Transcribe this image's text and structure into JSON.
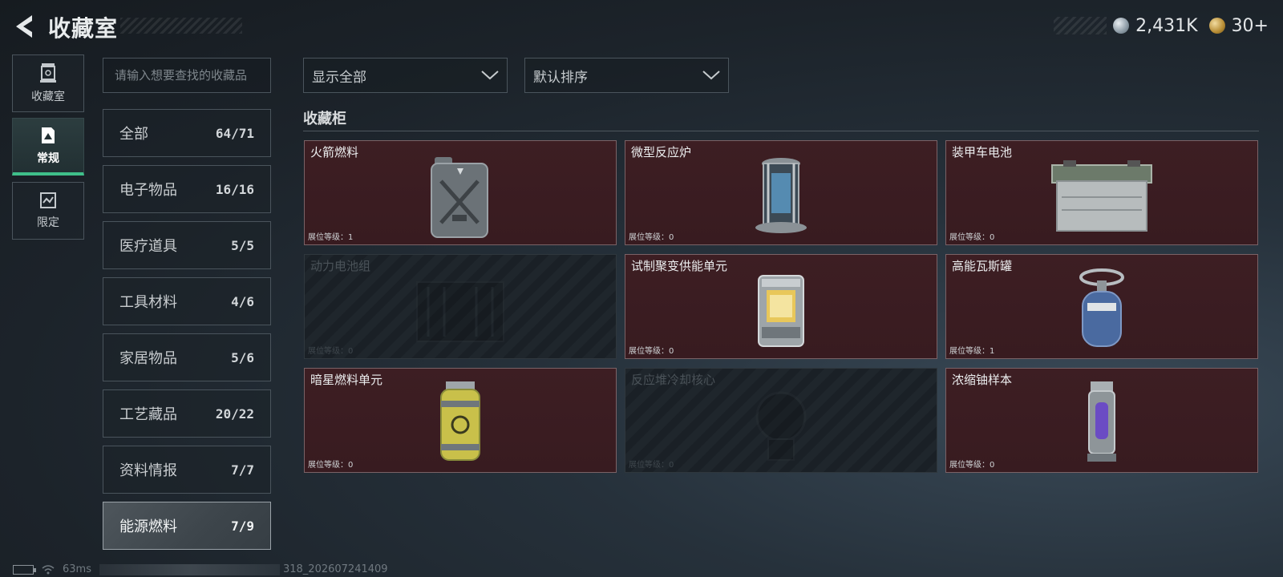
{
  "header": {
    "title": "收藏室",
    "currency": [
      {
        "icon": "silver-coin-icon",
        "value": "2,431K"
      },
      {
        "icon": "gold-coin-icon",
        "value": "30+"
      }
    ]
  },
  "rail": {
    "items": [
      {
        "label": "收藏室",
        "icon": "collection-room-icon",
        "active": false
      },
      {
        "label": "常规",
        "icon": "regular-icon",
        "active": true
      },
      {
        "label": "限定",
        "icon": "limited-icon",
        "active": false
      }
    ]
  },
  "search": {
    "placeholder": "请输入想要查找的收藏品"
  },
  "categories": [
    {
      "label": "全部",
      "count": "64/71"
    },
    {
      "label": "电子物品",
      "count": "16/16"
    },
    {
      "label": "医疗道具",
      "count": "5/5"
    },
    {
      "label": "工具材料",
      "count": "4/6"
    },
    {
      "label": "家居物品",
      "count": "5/6"
    },
    {
      "label": "工艺藏品",
      "count": "20/22"
    },
    {
      "label": "资料情报",
      "count": "7/7"
    },
    {
      "label": "能源燃料",
      "count": "7/9"
    }
  ],
  "active_category": "能源燃料",
  "filters": {
    "display": "显示全部",
    "sort": "默认排序"
  },
  "cabinet": {
    "title": "收藏柜",
    "slots": [
      {
        "name": "火箭燃料",
        "level": "展位等级：1",
        "unlocked": true,
        "icon": "fuel-jerrycan-icon"
      },
      {
        "name": "微型反应炉",
        "level": "展位等级：0",
        "unlocked": true,
        "icon": "mini-reactor-icon"
      },
      {
        "name": "装甲车电池",
        "level": "展位等级：0",
        "unlocked": true,
        "icon": "vehicle-battery-icon"
      },
      {
        "name": "动力电池组",
        "level": "展位等级：0",
        "unlocked": false,
        "icon": "power-battery-pack-icon"
      },
      {
        "name": "试制聚变供能单元",
        "level": "展位等级：0",
        "unlocked": true,
        "icon": "fusion-unit-icon"
      },
      {
        "name": "高能瓦斯罐",
        "level": "展位等级：1",
        "unlocked": true,
        "icon": "gas-canister-icon"
      },
      {
        "name": "暗星燃料单元",
        "level": "展位等级：0",
        "unlocked": true,
        "icon": "darkstar-fuel-cell-icon"
      },
      {
        "name": "反应堆冷却核心",
        "level": "展位等级：0",
        "unlocked": false,
        "icon": "reactor-cooling-core-icon"
      },
      {
        "name": "浓缩铀样本",
        "level": "展位等级：0",
        "unlocked": true,
        "icon": "uranium-sample-icon"
      }
    ]
  },
  "footer": {
    "ping": "63ms",
    "build": "318_202607241409"
  },
  "colors": {
    "slot_unlocked": "#3d1e23",
    "active_tab_accent": "#3fbf8a"
  }
}
